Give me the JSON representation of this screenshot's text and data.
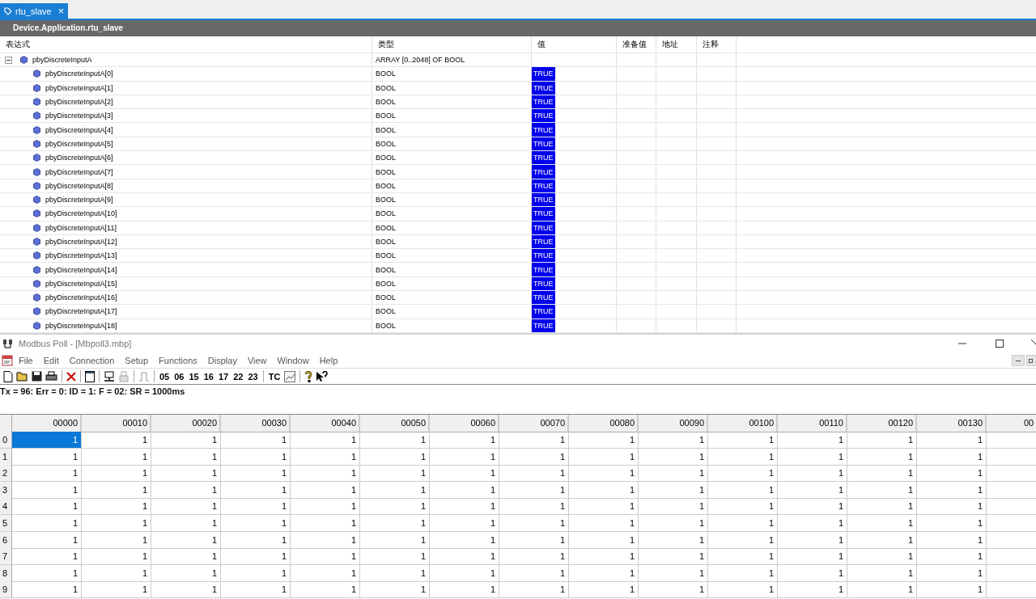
{
  "tab": {
    "label": "rtu_slave",
    "close": "×"
  },
  "watch": {
    "path": "Device.Application.rtu_slave",
    "columns": [
      "表达式",
      "类型",
      "值",
      "准备值",
      "地址",
      "注释"
    ],
    "parent": {
      "name": "pbyDiscreteInputA",
      "type": "ARRAY [0..2048] OF BOOL",
      "expanded": true,
      "children": [
        {
          "name": "pbyDiscreteInputA[0]",
          "type": "BOOL",
          "value": "TRUE"
        },
        {
          "name": "pbyDiscreteInputA[1]",
          "type": "BOOL",
          "value": "TRUE"
        },
        {
          "name": "pbyDiscreteInputA[2]",
          "type": "BOOL",
          "value": "TRUE"
        },
        {
          "name": "pbyDiscreteInputA[3]",
          "type": "BOOL",
          "value": "TRUE"
        },
        {
          "name": "pbyDiscreteInputA[4]",
          "type": "BOOL",
          "value": "TRUE"
        },
        {
          "name": "pbyDiscreteInputA[5]",
          "type": "BOOL",
          "value": "TRUE"
        },
        {
          "name": "pbyDiscreteInputA[6]",
          "type": "BOOL",
          "value": "TRUE"
        },
        {
          "name": "pbyDiscreteInputA[7]",
          "type": "BOOL",
          "value": "TRUE"
        },
        {
          "name": "pbyDiscreteInputA[8]",
          "type": "BOOL",
          "value": "TRUE"
        },
        {
          "name": "pbyDiscreteInputA[9]",
          "type": "BOOL",
          "value": "TRUE"
        },
        {
          "name": "pbyDiscreteInputA[10]",
          "type": "BOOL",
          "value": "TRUE"
        },
        {
          "name": "pbyDiscreteInputA[11]",
          "type": "BOOL",
          "value": "TRUE"
        },
        {
          "name": "pbyDiscreteInputA[12]",
          "type": "BOOL",
          "value": "TRUE"
        },
        {
          "name": "pbyDiscreteInputA[13]",
          "type": "BOOL",
          "value": "TRUE"
        },
        {
          "name": "pbyDiscreteInputA[14]",
          "type": "BOOL",
          "value": "TRUE"
        },
        {
          "name": "pbyDiscreteInputA[15]",
          "type": "BOOL",
          "value": "TRUE"
        },
        {
          "name": "pbyDiscreteInputA[16]",
          "type": "BOOL",
          "value": "TRUE"
        },
        {
          "name": "pbyDiscreteInputA[17]",
          "type": "BOOL",
          "value": "TRUE"
        },
        {
          "name": "pbyDiscreteInputA[18]",
          "type": "BOOL",
          "value": "TRUE"
        }
      ]
    }
  },
  "modbus": {
    "title": "Modbus Poll - [Mbpoll3.mbp]",
    "menu": [
      "File",
      "Edit",
      "Connection",
      "Setup",
      "Functions",
      "Display",
      "View",
      "Window",
      "Help"
    ],
    "function_codes": [
      "05",
      "06",
      "15",
      "16",
      "17",
      "22",
      "23"
    ],
    "tc_label": "TC",
    "status": "Tx = 96: Err = 0: ID = 1: F = 02: SR = 1000ms",
    "columns": [
      "00000",
      "00010",
      "00020",
      "00030",
      "00040",
      "00050",
      "00060",
      "00070",
      "00080",
      "00090",
      "00100",
      "00110",
      "00120",
      "00130",
      "00"
    ],
    "rows": [
      {
        "label": "0",
        "cells": [
          {
            "value": "1",
            "selected": true
          },
          {
            "value": "1",
            "selected": false
          },
          {
            "value": "1",
            "selected": false
          },
          {
            "value": "1",
            "selected": false
          },
          {
            "value": "1",
            "selected": false
          },
          {
            "value": "1",
            "selected": false
          },
          {
            "value": "1",
            "selected": false
          },
          {
            "value": "1",
            "selected": false
          },
          {
            "value": "1",
            "selected": false
          },
          {
            "value": "1",
            "selected": false
          },
          {
            "value": "1",
            "selected": false
          },
          {
            "value": "1",
            "selected": false
          },
          {
            "value": "1",
            "selected": false
          },
          {
            "value": "1",
            "selected": false
          }
        ]
      },
      {
        "label": "1",
        "cells": [
          {
            "value": "1",
            "selected": false
          },
          {
            "value": "1",
            "selected": false
          },
          {
            "value": "1",
            "selected": false
          },
          {
            "value": "1",
            "selected": false
          },
          {
            "value": "1",
            "selected": false
          },
          {
            "value": "1",
            "selected": false
          },
          {
            "value": "1",
            "selected": false
          },
          {
            "value": "1",
            "selected": false
          },
          {
            "value": "1",
            "selected": false
          },
          {
            "value": "1",
            "selected": false
          },
          {
            "value": "1",
            "selected": false
          },
          {
            "value": "1",
            "selected": false
          },
          {
            "value": "1",
            "selected": false
          },
          {
            "value": "1",
            "selected": false
          }
        ]
      },
      {
        "label": "2",
        "cells": [
          {
            "value": "1",
            "selected": false
          },
          {
            "value": "1",
            "selected": false
          },
          {
            "value": "1",
            "selected": false
          },
          {
            "value": "1",
            "selected": false
          },
          {
            "value": "1",
            "selected": false
          },
          {
            "value": "1",
            "selected": false
          },
          {
            "value": "1",
            "selected": false
          },
          {
            "value": "1",
            "selected": false
          },
          {
            "value": "1",
            "selected": false
          },
          {
            "value": "1",
            "selected": false
          },
          {
            "value": "1",
            "selected": false
          },
          {
            "value": "1",
            "selected": false
          },
          {
            "value": "1",
            "selected": false
          },
          {
            "value": "1",
            "selected": false
          }
        ]
      },
      {
        "label": "3",
        "cells": [
          {
            "value": "1",
            "selected": false
          },
          {
            "value": "1",
            "selected": false
          },
          {
            "value": "1",
            "selected": false
          },
          {
            "value": "1",
            "selected": false
          },
          {
            "value": "1",
            "selected": false
          },
          {
            "value": "1",
            "selected": false
          },
          {
            "value": "1",
            "selected": false
          },
          {
            "value": "1",
            "selected": false
          },
          {
            "value": "1",
            "selected": false
          },
          {
            "value": "1",
            "selected": false
          },
          {
            "value": "1",
            "selected": false
          },
          {
            "value": "1",
            "selected": false
          },
          {
            "value": "1",
            "selected": false
          },
          {
            "value": "1",
            "selected": false
          }
        ]
      },
      {
        "label": "4",
        "cells": [
          {
            "value": "1",
            "selected": false
          },
          {
            "value": "1",
            "selected": false
          },
          {
            "value": "1",
            "selected": false
          },
          {
            "value": "1",
            "selected": false
          },
          {
            "value": "1",
            "selected": false
          },
          {
            "value": "1",
            "selected": false
          },
          {
            "value": "1",
            "selected": false
          },
          {
            "value": "1",
            "selected": false
          },
          {
            "value": "1",
            "selected": false
          },
          {
            "value": "1",
            "selected": false
          },
          {
            "value": "1",
            "selected": false
          },
          {
            "value": "1",
            "selected": false
          },
          {
            "value": "1",
            "selected": false
          },
          {
            "value": "1",
            "selected": false
          }
        ]
      },
      {
        "label": "5",
        "cells": [
          {
            "value": "1",
            "selected": false
          },
          {
            "value": "1",
            "selected": false
          },
          {
            "value": "1",
            "selected": false
          },
          {
            "value": "1",
            "selected": false
          },
          {
            "value": "1",
            "selected": false
          },
          {
            "value": "1",
            "selected": false
          },
          {
            "value": "1",
            "selected": false
          },
          {
            "value": "1",
            "selected": false
          },
          {
            "value": "1",
            "selected": false
          },
          {
            "value": "1",
            "selected": false
          },
          {
            "value": "1",
            "selected": false
          },
          {
            "value": "1",
            "selected": false
          },
          {
            "value": "1",
            "selected": false
          },
          {
            "value": "1",
            "selected": false
          }
        ]
      },
      {
        "label": "6",
        "cells": [
          {
            "value": "1",
            "selected": false
          },
          {
            "value": "1",
            "selected": false
          },
          {
            "value": "1",
            "selected": false
          },
          {
            "value": "1",
            "selected": false
          },
          {
            "value": "1",
            "selected": false
          },
          {
            "value": "1",
            "selected": false
          },
          {
            "value": "1",
            "selected": false
          },
          {
            "value": "1",
            "selected": false
          },
          {
            "value": "1",
            "selected": false
          },
          {
            "value": "1",
            "selected": false
          },
          {
            "value": "1",
            "selected": false
          },
          {
            "value": "1",
            "selected": false
          },
          {
            "value": "1",
            "selected": false
          },
          {
            "value": "1",
            "selected": false
          }
        ]
      },
      {
        "label": "7",
        "cells": [
          {
            "value": "1",
            "selected": false
          },
          {
            "value": "1",
            "selected": false
          },
          {
            "value": "1",
            "selected": false
          },
          {
            "value": "1",
            "selected": false
          },
          {
            "value": "1",
            "selected": false
          },
          {
            "value": "1",
            "selected": false
          },
          {
            "value": "1",
            "selected": false
          },
          {
            "value": "1",
            "selected": false
          },
          {
            "value": "1",
            "selected": false
          },
          {
            "value": "1",
            "selected": false
          },
          {
            "value": "1",
            "selected": false
          },
          {
            "value": "1",
            "selected": false
          },
          {
            "value": "1",
            "selected": false
          },
          {
            "value": "1",
            "selected": false
          }
        ]
      },
      {
        "label": "8",
        "cells": [
          {
            "value": "1",
            "selected": false
          },
          {
            "value": "1",
            "selected": false
          },
          {
            "value": "1",
            "selected": false
          },
          {
            "value": "1",
            "selected": false
          },
          {
            "value": "1",
            "selected": false
          },
          {
            "value": "1",
            "selected": false
          },
          {
            "value": "1",
            "selected": false
          },
          {
            "value": "1",
            "selected": false
          },
          {
            "value": "1",
            "selected": false
          },
          {
            "value": "1",
            "selected": false
          },
          {
            "value": "1",
            "selected": false
          },
          {
            "value": "1",
            "selected": false
          },
          {
            "value": "1",
            "selected": false
          },
          {
            "value": "1",
            "selected": false
          }
        ]
      },
      {
        "label": "9",
        "cells": [
          {
            "value": "1",
            "selected": false
          },
          {
            "value": "1",
            "selected": false
          },
          {
            "value": "1",
            "selected": false
          },
          {
            "value": "1",
            "selected": false
          },
          {
            "value": "1",
            "selected": false
          },
          {
            "value": "1",
            "selected": false
          },
          {
            "value": "1",
            "selected": false
          },
          {
            "value": "1",
            "selected": false
          },
          {
            "value": "1",
            "selected": false
          },
          {
            "value": "1",
            "selected": false
          },
          {
            "value": "1",
            "selected": false
          },
          {
            "value": "1",
            "selected": false
          },
          {
            "value": "1",
            "selected": false
          },
          {
            "value": "1",
            "selected": false
          }
        ]
      }
    ]
  }
}
